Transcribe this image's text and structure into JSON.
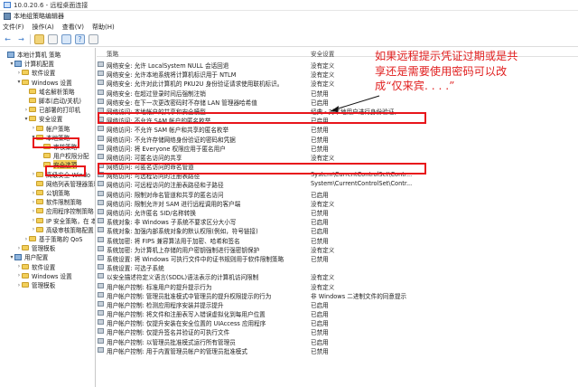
{
  "window": {
    "title": "10.0.20.6 - 远程桌面连接",
    "app_title": "本地组策略编辑器"
  },
  "menu": [
    "文件(F)",
    "操作(A)",
    "查看(V)",
    "帮助(H)"
  ],
  "toolbar": [
    "back-icon",
    "forward-icon",
    "folder-icon",
    "document-icon",
    "properties-icon",
    "help-icon",
    "refresh-icon"
  ],
  "tree": [
    {
      "label": "本地计算机 策略",
      "level": 0,
      "expand": "",
      "icon": "pc"
    },
    {
      "label": "计算机配置",
      "level": 1,
      "expand": "▾",
      "icon": "pc"
    },
    {
      "label": "软件设置",
      "level": 2,
      "expand": "›",
      "icon": "folder"
    },
    {
      "label": "Windows 设置",
      "level": 2,
      "expand": "▾",
      "icon": "folder"
    },
    {
      "label": "域名解析策略",
      "level": 3,
      "expand": "",
      "icon": "folder"
    },
    {
      "label": "脚本(启动/关机)",
      "level": 3,
      "expand": "",
      "icon": "folder"
    },
    {
      "label": "已部署的打印机",
      "level": 3,
      "expand": "›",
      "icon": "folder"
    },
    {
      "label": "安全设置",
      "level": 3,
      "expand": "▾",
      "icon": "folder"
    },
    {
      "label": "帐户策略",
      "level": 4,
      "expand": "›",
      "icon": "folder"
    },
    {
      "label": "本地策略",
      "level": 4,
      "expand": "▾",
      "icon": "folder"
    },
    {
      "label": "审核策略",
      "level": 5,
      "expand": "",
      "icon": "folder"
    },
    {
      "label": "用户权限分配",
      "level": 5,
      "expand": "",
      "icon": "folder"
    },
    {
      "label": "安全选项",
      "level": 5,
      "expand": "",
      "icon": "folder"
    },
    {
      "label": "高级安全 Windo",
      "level": 4,
      "expand": "›",
      "icon": "folder"
    },
    {
      "label": "网络列表管理器策略",
      "level": 4,
      "expand": "",
      "icon": "folder"
    },
    {
      "label": "公钥策略",
      "level": 4,
      "expand": "›",
      "icon": "folder"
    },
    {
      "label": "软件限制策略",
      "level": 4,
      "expand": "›",
      "icon": "folder"
    },
    {
      "label": "应用程序控制策略",
      "level": 4,
      "expand": "›",
      "icon": "folder"
    },
    {
      "label": "IP 安全策略，在 本",
      "level": 4,
      "expand": "›",
      "icon": "folder"
    },
    {
      "label": "高级审核策略配置",
      "level": 4,
      "expand": "›",
      "icon": "folder"
    },
    {
      "label": "基于策略的 QoS",
      "level": 3,
      "expand": "›",
      "icon": "folder"
    },
    {
      "label": "管理模板",
      "level": 2,
      "expand": "›",
      "icon": "folder"
    },
    {
      "label": "用户配置",
      "level": 1,
      "expand": "▾",
      "icon": "pc"
    },
    {
      "label": "软件设置",
      "level": 2,
      "expand": "›",
      "icon": "folder"
    },
    {
      "label": "Windows 设置",
      "level": 2,
      "expand": "›",
      "icon": "folder"
    },
    {
      "label": "管理模板",
      "level": 2,
      "expand": "›",
      "icon": "folder"
    }
  ],
  "columns": {
    "policy": "策略",
    "setting": "安全设置"
  },
  "rows": [
    {
      "policy": "网络安全: 允许 LocalSystem NULL 会话回退",
      "setting": "没有定义"
    },
    {
      "policy": "网络安全: 允许本地系统将计算机标识用于 NTLM",
      "setting": "没有定义"
    },
    {
      "policy": "网络安全: 允许对此计算机的 PKU2U 身份验证请求使用联机标识。",
      "setting": "没有定义"
    },
    {
      "policy": "网络安全: 在超过登录时间后强制注销",
      "setting": "已禁用"
    },
    {
      "policy": "网络安全: 在下一次更改密码时不存储 LAN 管理器哈希值",
      "setting": "已启用"
    },
    {
      "policy": "网络访问: 本地帐户的共享和安全模型",
      "setting": "经典 - 对本地用户进行身份验证，..."
    },
    {
      "policy": "网络访问: 不允许 SAM 帐户的匿名枚举",
      "setting": "已启用"
    },
    {
      "policy": "网络访问: 不允许 SAM 帐户和共享的匿名枚举",
      "setting": "已禁用"
    },
    {
      "policy": "网络访问: 不允许存储网络身份验证的密码和凭据",
      "setting": "已禁用"
    },
    {
      "policy": "网络访问: 将 Everyone 权限应用于匿名用户",
      "setting": "已禁用"
    },
    {
      "policy": "网络访问: 可匿名访问的共享",
      "setting": "没有定义"
    },
    {
      "policy": "网络访问: 可匿名访问的命名管道",
      "setting": ""
    },
    {
      "policy": "网络访问: 可远程访问的注册表路径",
      "setting": "System\\CurrentControlSet\\Contr..."
    },
    {
      "policy": "网络访问: 可远程访问的注册表路径和子路径",
      "setting": "System\\CurrentControlSet\\Contr..."
    },
    {
      "policy": "网络访问: 限制对命名管道和共享的匿名访问",
      "setting": "已启用"
    },
    {
      "policy": "网络访问: 限制允许对 SAM 进行远程调用的客户端",
      "setting": "没有定义"
    },
    {
      "policy": "网络访问: 允许匿名 SID/名称转换",
      "setting": "已禁用"
    },
    {
      "policy": "系统对象: 非 Windows 子系统不要求区分大小写",
      "setting": "已启用"
    },
    {
      "policy": "系统对象: 加强内部系统对象的默认权限(例如，符号链接)",
      "setting": "已启用"
    },
    {
      "policy": "系统加密: 将 FIPS 兼容算法用于加密、哈希和签名",
      "setting": "已禁用"
    },
    {
      "policy": "系统加密: 为计算机上存储的用户密钥强制进行强密钥保护",
      "setting": "没有定义"
    },
    {
      "policy": "系统设置: 将 Windows 可执行文件中的证书规则用于软件限制策略",
      "setting": "已禁用"
    },
    {
      "policy": "系统设置: 可选子系统",
      "setting": ""
    },
    {
      "policy": "以安全描述符定义语言(SDDL)语法表示的计算机访问限制",
      "setting": "没有定义"
    },
    {
      "policy": "用户帐户控制: 标准用户的提升提示行为",
      "setting": "没有定义"
    },
    {
      "policy": "用户帐户控制: 管理员批准模式中管理员的提升权限提示的行为",
      "setting": "非 Windows 二进制文件的同意提示"
    },
    {
      "policy": "用户帐户控制: 检测应用程序安装并提示提升",
      "setting": "已启用"
    },
    {
      "policy": "用户帐户控制: 将文件和注册表写入错误虚拟化到每用户位置",
      "setting": "已启用"
    },
    {
      "policy": "用户帐户控制: 仅提升安装在安全位置的 UIAccess 应用程序",
      "setting": "已启用"
    },
    {
      "policy": "用户帐户控制: 仅提升签名并验证的可执行文件",
      "setting": "已禁用"
    },
    {
      "policy": "用户帐户控制: 以管理员批准模式运行所有管理员",
      "setting": "已启用"
    },
    {
      "policy": "用户帐户控制: 用于内置管理员帐户的管理员批准模式",
      "setting": "已禁用"
    }
  ],
  "annotation": "如果远程提示凭证过期或是共享还是需要使用密码可以改成“仅来宾. . . .”",
  "colors": {
    "highlight": "#e8151b",
    "annotation": "#e02020",
    "selected": "#f2cf5a"
  }
}
